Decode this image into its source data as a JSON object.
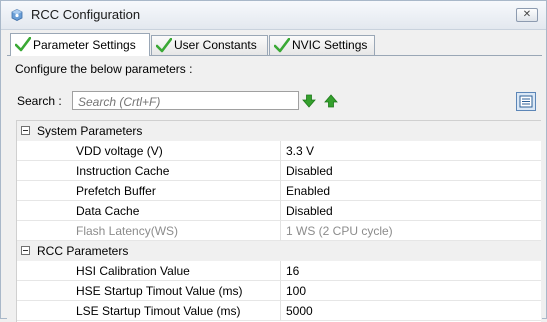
{
  "window": {
    "title": "RCC Configuration",
    "close_label": "✕",
    "icon": "gear-cube-icon"
  },
  "tabs": [
    {
      "label": "Parameter Settings",
      "active": true,
      "icon": "green-check-icon"
    },
    {
      "label": "User Constants",
      "active": false,
      "icon": "green-check-icon"
    },
    {
      "label": "NVIC Settings",
      "active": false,
      "icon": "green-check-icon"
    }
  ],
  "panel": {
    "instruction": "Configure the below parameters :",
    "search_label": "Search :",
    "search_placeholder": "Search (Crtl+F)",
    "search_value": "",
    "down_icon": "green-arrow-down-icon",
    "up_icon": "green-arrow-up-icon",
    "list_icon": "list-view-icon"
  },
  "groups": [
    {
      "label": "System Parameters",
      "params": [
        {
          "name": "VDD voltage (V)",
          "value": "3.3 V",
          "enabled": true
        },
        {
          "name": "Instruction Cache",
          "value": "Disabled",
          "enabled": true
        },
        {
          "name": "Prefetch Buffer",
          "value": "Enabled",
          "enabled": true
        },
        {
          "name": "Data Cache",
          "value": "Disabled",
          "enabled": true
        },
        {
          "name": "Flash Latency(WS)",
          "value": "1 WS (2 CPU cycle)",
          "enabled": false
        }
      ]
    },
    {
      "label": "RCC Parameters",
      "params": [
        {
          "name": "HSI Calibration Value",
          "value": "16",
          "enabled": true
        },
        {
          "name": "HSE Startup Timout Value (ms)",
          "value": "100",
          "enabled": true
        },
        {
          "name": "LSE Startup Timout Value (ms)",
          "value": "5000",
          "enabled": true
        }
      ]
    }
  ],
  "colors": {
    "check_green": "#3aa935",
    "arrow_green": "#35a02d"
  }
}
